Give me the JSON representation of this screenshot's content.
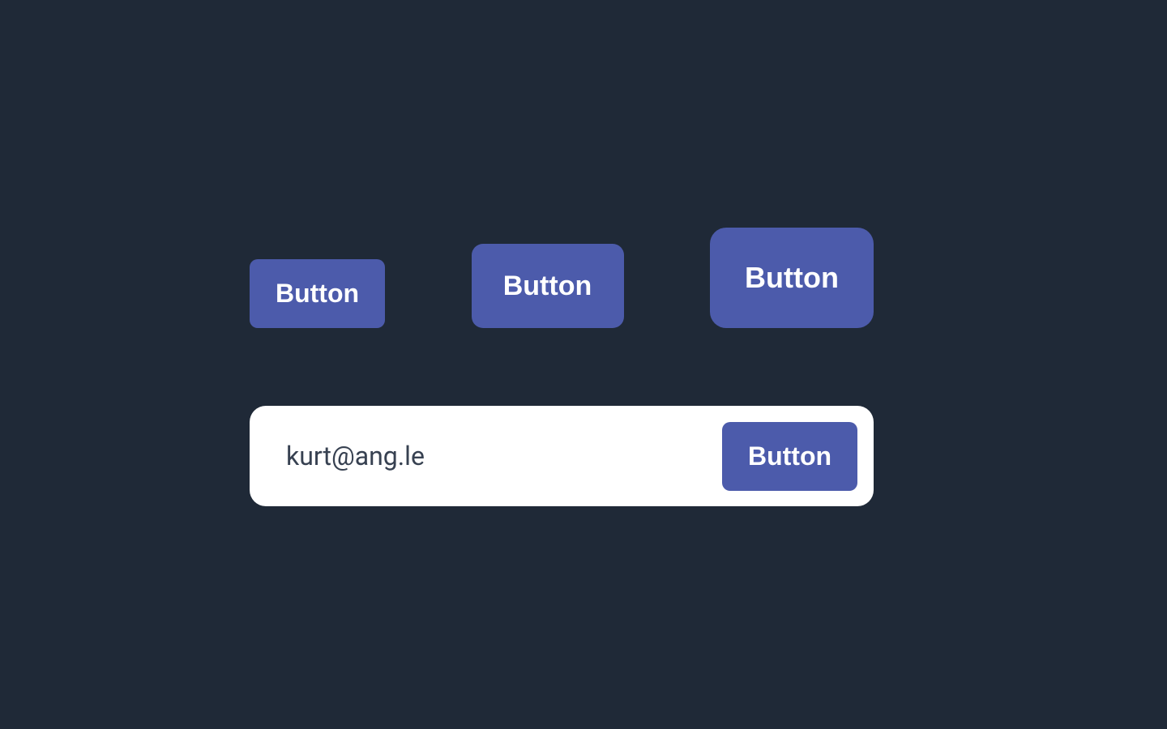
{
  "buttons": {
    "small": "Button",
    "medium": "Button",
    "large": "Button"
  },
  "search": {
    "value": "kurt@ang.le",
    "button_label": "Button"
  },
  "colors": {
    "background": "#1f2937",
    "button_bg": "#4c5bab",
    "button_text": "#ffffff",
    "input_bg": "#ffffff",
    "input_text": "#374151"
  }
}
